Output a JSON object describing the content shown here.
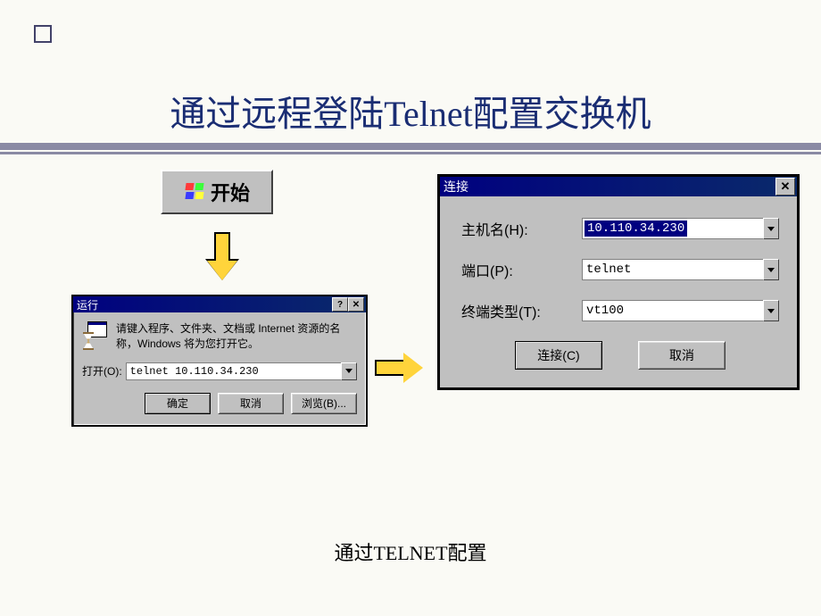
{
  "slide": {
    "title": "通过远程登陆Telnet配置交换机",
    "caption": "通过TELNET配置"
  },
  "start_button": {
    "label": "开始"
  },
  "run_dialog": {
    "title": "运行",
    "description": "请键入程序、文件夹、文档或 Internet 资源的名称，Windows 将为您打开它。",
    "open_label": "打开(O):",
    "open_value": "telnet 10.110.34.230",
    "buttons": {
      "ok": "确定",
      "cancel": "取消",
      "browse": "浏览(B)..."
    }
  },
  "connect_dialog": {
    "title": "连接",
    "fields": {
      "host_label": "主机名(H):",
      "host_value": "10.110.34.230",
      "port_label": "端口(P):",
      "port_value": "telnet",
      "term_label": "终端类型(T):",
      "term_value": "vt100"
    },
    "buttons": {
      "connect": "连接(C)",
      "cancel": "取消"
    }
  }
}
